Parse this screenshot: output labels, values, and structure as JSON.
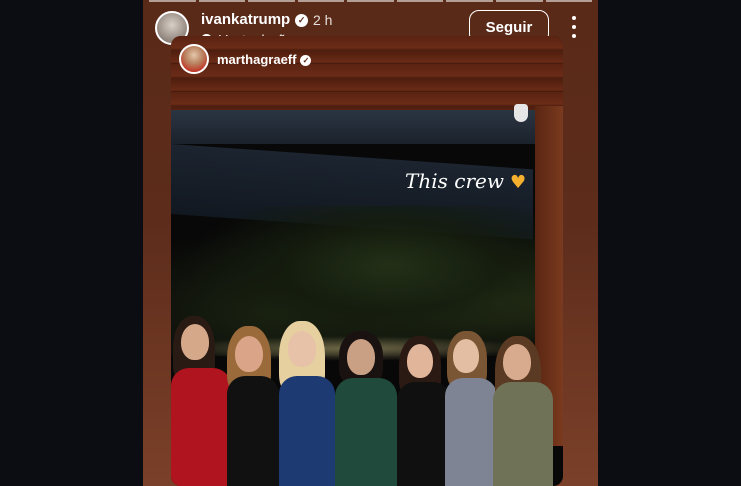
{
  "story": {
    "progress_segments": 9,
    "author": {
      "username": "ivankatrump",
      "verified": true,
      "time_ago": "2 h",
      "translate_label": "Ver tradução",
      "avatar_icon": "avatar-icon"
    },
    "follow_button_label": "Seguir",
    "more_icon": "more-options-icon",
    "mention": {
      "username": "marthagraeff",
      "verified": true
    },
    "caption": {
      "text": "This crew",
      "emoji_icon": "heart-hands-icon",
      "emoji_color": "#f5b02d"
    }
  },
  "colors": {
    "page_background": "#0b0d12",
    "story_gradient_top": "#5a2a18",
    "story_gradient_bottom": "#7b4029",
    "text": "#ffffff"
  }
}
